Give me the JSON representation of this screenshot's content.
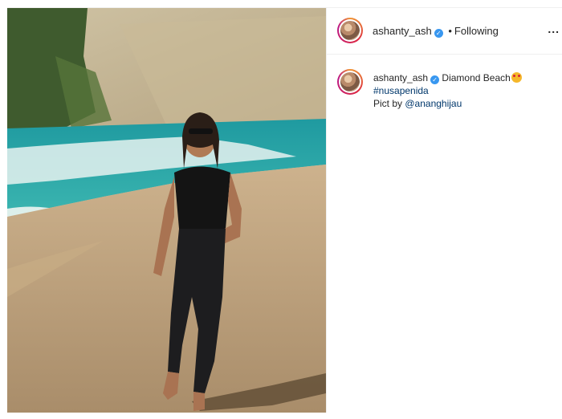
{
  "post": {
    "username": "ashanty_ash",
    "follow_status": "Following",
    "separator": "•",
    "more_label": "...",
    "caption": {
      "username": "ashanty_ash",
      "text": "Diamond Beach",
      "emoji": "star-struck-emoji",
      "hashtag": "#nusapenida",
      "credit_prefix": "Pict by",
      "mention": "@ananghijau"
    },
    "verified_icon": "verified-badge-icon",
    "photo": "beach-photo-woman-walking"
  },
  "colors": {
    "link": "#00376b",
    "verified": "#3897f0",
    "border": "#efefef"
  }
}
